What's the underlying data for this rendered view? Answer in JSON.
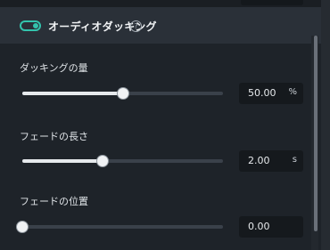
{
  "header": {
    "title": "オーディオダッキング",
    "toggle_on": true,
    "help_glyph": "?"
  },
  "sliders": [
    {
      "label": "ダッキングの量",
      "value": "50.00",
      "unit": "%",
      "fraction": 0.5
    },
    {
      "label": "フェードの長さ",
      "value": "2.00",
      "unit": "s",
      "fraction": 0.4
    },
    {
      "label": "フェードの位置",
      "value": "0.00",
      "unit": "",
      "fraction": 0.0
    }
  ],
  "colors": {
    "accent": "#33c4ad",
    "panel": "#1e2329",
    "header": "#2a3038"
  }
}
